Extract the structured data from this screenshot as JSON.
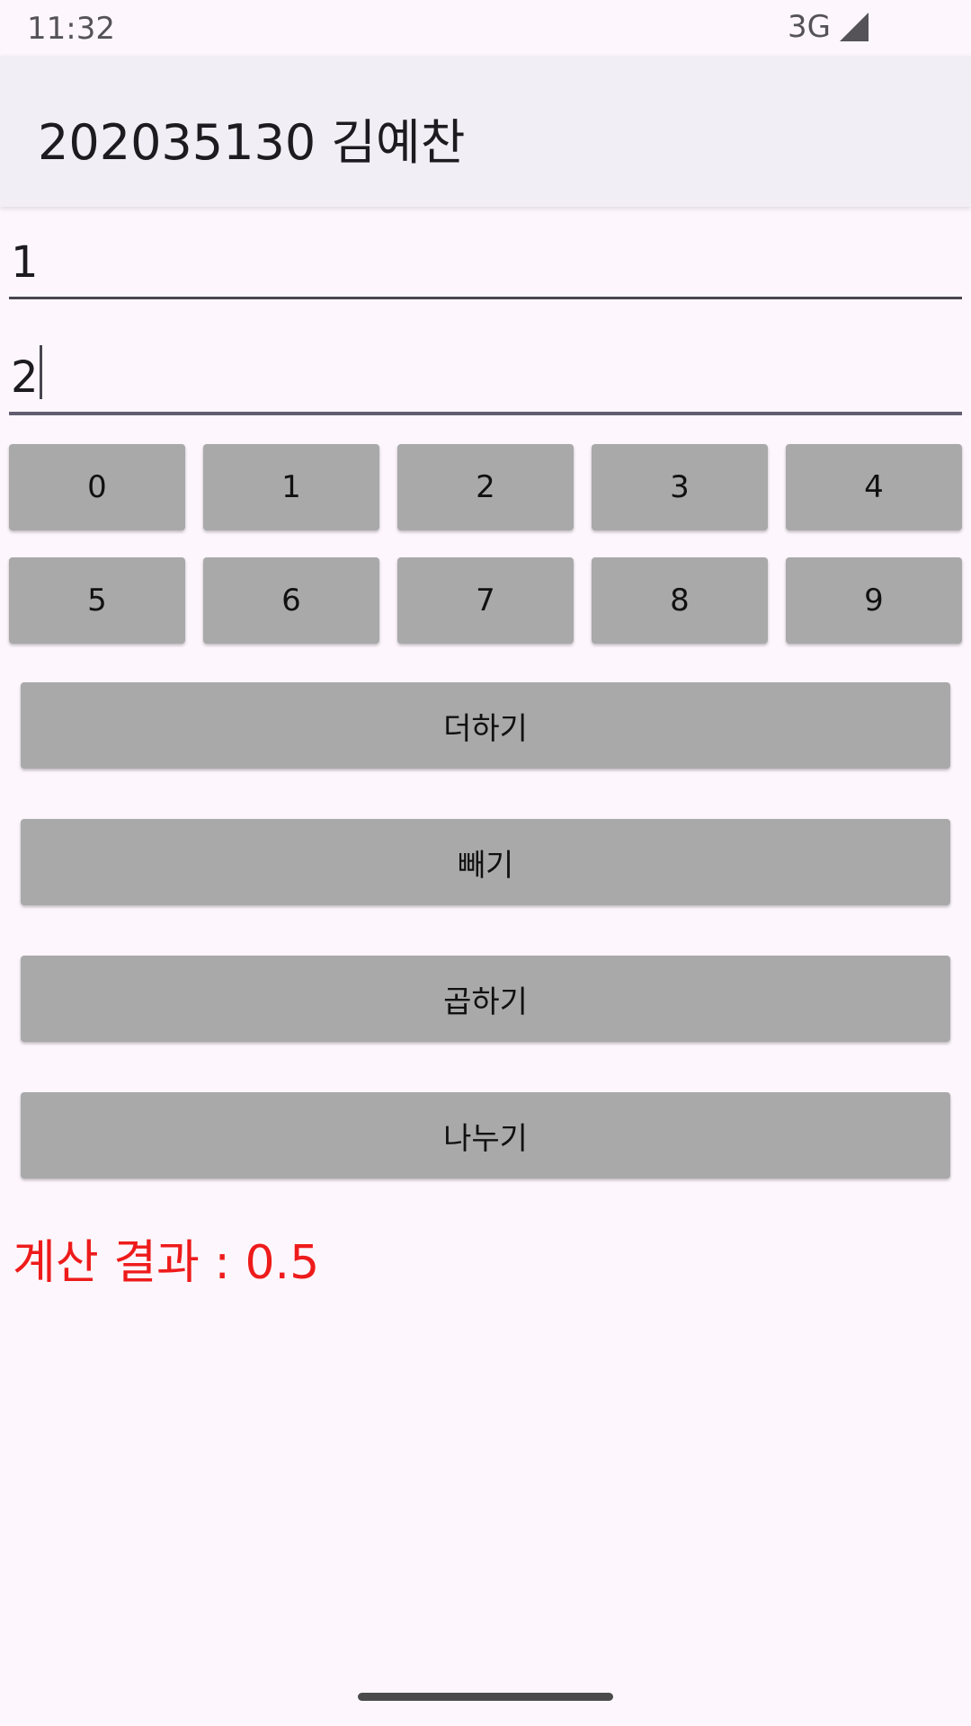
{
  "status_bar": {
    "time": "11:32",
    "network": "3G",
    "signal_icon": "signal-icon"
  },
  "app_bar": {
    "title": "202035130 김예찬"
  },
  "inputs": {
    "first_value": "1",
    "second_value": "2"
  },
  "digits": [
    "0",
    "1",
    "2",
    "3",
    "4",
    "5",
    "6",
    "7",
    "8",
    "9"
  ],
  "operations": {
    "add": "더하기",
    "subtract": "빼기",
    "multiply": "곱하기",
    "divide": "나누기"
  },
  "result": {
    "text": "계산 결과 : 0.5",
    "color": "#ee1b1b"
  }
}
